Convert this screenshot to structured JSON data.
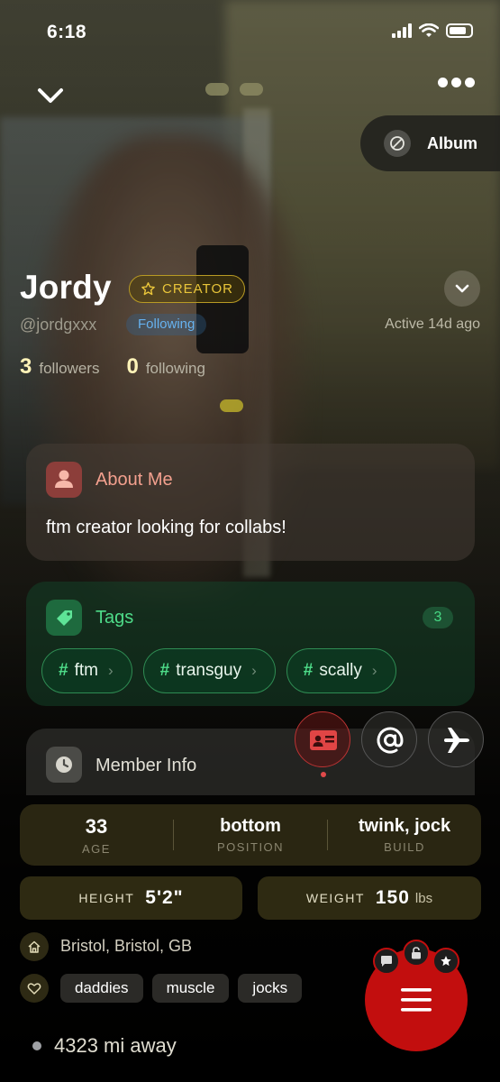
{
  "status_bar": {
    "time": "6:18"
  },
  "header": {
    "album_label": "Album",
    "page_count": 3,
    "active_page": 1
  },
  "profile": {
    "name": "Jordy",
    "badge": "CREATOR",
    "handle": "@jordgxxx",
    "follow_state": "Following",
    "active": "Active 14d ago",
    "followers_count": "3",
    "followers_label": "followers",
    "following_count": "0",
    "following_label": "following"
  },
  "about": {
    "title": "About Me",
    "text": "ftm creator looking for collabs!"
  },
  "tags": {
    "title": "Tags",
    "count": "3",
    "items": [
      {
        "hash": "#",
        "label": "ftm"
      },
      {
        "hash": "#",
        "label": "transguy"
      },
      {
        "hash": "#",
        "label": "scally"
      }
    ]
  },
  "member_info": {
    "title": "Member Info",
    "age_value": "33",
    "age_label": "AGE",
    "position_value": "bottom",
    "position_label": "POSITION",
    "build_value": "twink, jock",
    "build_label": "BUILD",
    "height_label": "HEIGHT",
    "height_value": "5'2\"",
    "weight_label": "WEIGHT",
    "weight_value": "150",
    "weight_unit": "lbs",
    "location": "Bristol, Bristol, GB",
    "likes": [
      "daddies",
      "muscle",
      "jocks"
    ],
    "distance": "4323 mi away"
  },
  "colors": {
    "creator_gold": "#e9c53a",
    "following_blue": "#66b2ef",
    "tags_green": "#4edc89",
    "about_salmon": "#f3a08e",
    "menu_red": "#c20e0e"
  },
  "icons": {
    "back": "chevron-down-icon",
    "more": "more-dots-icon",
    "album": "block-icon",
    "badge": "star-icon",
    "expand": "chevron-down-icon",
    "about": "person-icon",
    "tags": "tag-icon",
    "member": "clock-icon",
    "id_card": "id-card-icon",
    "mention": "at-icon",
    "travel": "plane-icon",
    "location": "home-icon",
    "likes": "heart-icon",
    "menu": "hamburger-icon",
    "chat": "chat-icon",
    "unlock": "unlock-icon",
    "favorite": "star-icon"
  }
}
